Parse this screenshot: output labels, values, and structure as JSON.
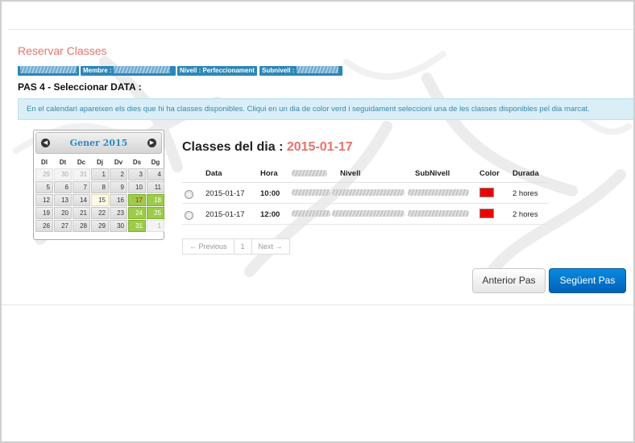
{
  "page": {
    "title": "Reservar Classes",
    "tags": [
      {
        "label": ""
      },
      {
        "label": "Membre :"
      },
      {
        "label": "Nivell : Perfeccionament"
      },
      {
        "label": "Subnivell :"
      }
    ],
    "step_title": "PAS 4 - Seleccionar DATA :",
    "info": "En el calendari apareixen els dies que hi ha classes disponibles. Cliqui en un dia de color verd i seguidament seleccioni una de les classes disponibles pel dia marcat."
  },
  "calendar": {
    "title": "Gener 2015",
    "prev_icon": "◀",
    "next_icon": "▶",
    "weekdays": [
      "Dl",
      "Dt",
      "Dc",
      "Dj",
      "Dv",
      "Ds",
      "Dg"
    ],
    "days": [
      {
        "d": "29",
        "s": "other"
      },
      {
        "d": "30",
        "s": "other"
      },
      {
        "d": "31",
        "s": "other"
      },
      {
        "d": "1",
        "s": ""
      },
      {
        "d": "2",
        "s": ""
      },
      {
        "d": "3",
        "s": ""
      },
      {
        "d": "4",
        "s": ""
      },
      {
        "d": "5",
        "s": ""
      },
      {
        "d": "6",
        "s": ""
      },
      {
        "d": "7",
        "s": ""
      },
      {
        "d": "8",
        "s": ""
      },
      {
        "d": "9",
        "s": ""
      },
      {
        "d": "10",
        "s": ""
      },
      {
        "d": "11",
        "s": ""
      },
      {
        "d": "12",
        "s": ""
      },
      {
        "d": "13",
        "s": ""
      },
      {
        "d": "14",
        "s": ""
      },
      {
        "d": "15",
        "s": "today"
      },
      {
        "d": "16",
        "s": ""
      },
      {
        "d": "17",
        "s": "sel"
      },
      {
        "d": "18",
        "s": "avail"
      },
      {
        "d": "19",
        "s": ""
      },
      {
        "d": "20",
        "s": ""
      },
      {
        "d": "21",
        "s": ""
      },
      {
        "d": "22",
        "s": ""
      },
      {
        "d": "23",
        "s": ""
      },
      {
        "d": "24",
        "s": "avail"
      },
      {
        "d": "25",
        "s": "avail"
      },
      {
        "d": "26",
        "s": ""
      },
      {
        "d": "27",
        "s": ""
      },
      {
        "d": "28",
        "s": ""
      },
      {
        "d": "29",
        "s": ""
      },
      {
        "d": "30",
        "s": ""
      },
      {
        "d": "31",
        "s": "avail"
      },
      {
        "d": "1",
        "s": "other"
      }
    ]
  },
  "classes": {
    "title_prefix": "Classes del dia :",
    "title_date": "2015-01-17",
    "headers": {
      "data": "Data",
      "hora": "Hora",
      "nivell": "Nivell",
      "subnivell": "SubNivell",
      "color": "Color",
      "durada": "Durada"
    },
    "rows": [
      {
        "data": "2015-01-17",
        "hora": "10:00",
        "color": "#ee0000",
        "durada": "2 hores"
      },
      {
        "data": "2015-01-17",
        "hora": "12:00",
        "color": "#ee0000",
        "durada": "2 hores"
      }
    ]
  },
  "pager": {
    "previous": "← Previous",
    "page": "1",
    "next": "Next →"
  },
  "buttons": {
    "previous_step": "Anterior Pas",
    "next_step": "Següent Pas"
  },
  "colors": {
    "accent": "#e8726b",
    "tag": "#2d86b8",
    "available_day": "#9dcc4a",
    "primary_button": "#0070cc"
  }
}
